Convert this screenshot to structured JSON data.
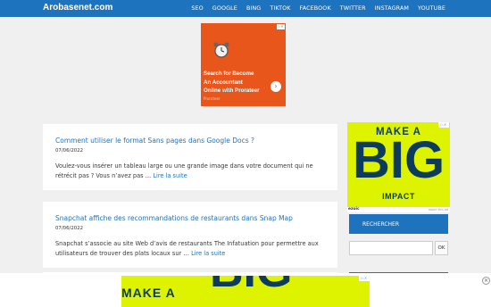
{
  "header": {
    "brand": "Arobasenet.com",
    "nav": [
      "SEO",
      "GOOGLE",
      "BING",
      "TIKTOK",
      "FACEBOOK",
      "TWITTER",
      "INSTAGRAM",
      "YOUTUBE"
    ]
  },
  "top_ad": {
    "text": [
      "Search for Become",
      "An Accountant",
      "Online with Prorateer"
    ],
    "source": "Prorateer",
    "arrow": "›"
  },
  "posts": [
    {
      "title": "Comment utiliser le format Sans pages dans Google Docs ?",
      "date": "07/06/2022",
      "excerpt": "Voulez-vous insérer un tableau large ou une grande image dans votre document qui ne rétrécit pas ? Vous n’avez pas …",
      "more": "Lire la suite"
    },
    {
      "title": "Snapchat affiche des recommandations de restaurants dans Snap Map",
      "date": "07/06/2022",
      "excerpt": "Snapchat s’associe au site Web d’avis de restaurants The Infatuation pour permettre aux utilisateurs de trouver des plats locaux sur …",
      "more": "Lire la suite"
    }
  ],
  "side_ad": {
    "line1": "MAKE A",
    "line2": "BIG",
    "line3": "IMPACT",
    "ezoic": "ezoic",
    "report": "report this ad"
  },
  "sidebar": {
    "search_heading": "RECHERCHER",
    "search_placeholder": "",
    "ok_label": "OK"
  },
  "bottom_ad": {
    "line1": "MAKE A",
    "line2": "BIG",
    "close": "×"
  },
  "colors": {
    "accent": "#1e73be",
    "ad_yellow": "#ddf300",
    "ad_orange": "#e8561c",
    "ad_navy": "#0d3b5e"
  }
}
